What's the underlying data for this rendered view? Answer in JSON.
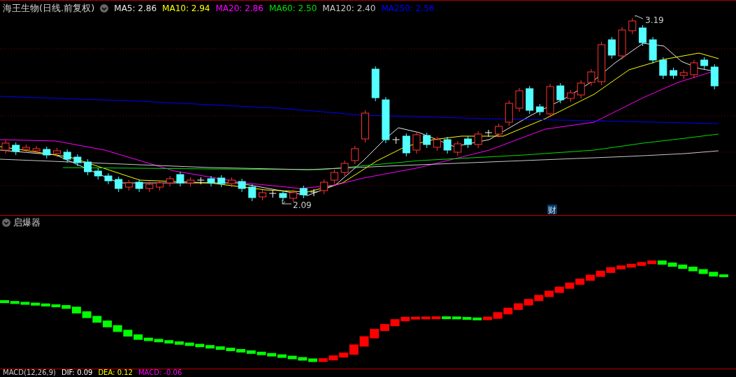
{
  "header": {
    "title": "海王生物(日线.前复权)",
    "indicators": [
      {
        "label": "MA5: 2.86",
        "color": "#e8e8e8"
      },
      {
        "label": "MA10: 2.94",
        "color": "#ffff00"
      },
      {
        "label": "MA20: 2.86",
        "color": "#ff00ff"
      },
      {
        "label": "MA60: 2.50",
        "color": "#00e000"
      },
      {
        "label": "MA120: 2.40",
        "color": "#c8c8c8"
      },
      {
        "label": "MA250: 2.56",
        "color": "#0000ff"
      }
    ]
  },
  "price_chart": {
    "high_label": "3.19",
    "low_label": "2.09",
    "badge": "财"
  },
  "sub_panel": {
    "title": "启爆器"
  },
  "macd_legend": {
    "title": "MACD(12,26,9)",
    "items": [
      {
        "label": "DIF: 0.09",
        "color": "#ffffff"
      },
      {
        "label": "DEA: 0.12",
        "color": "#ffff00"
      },
      {
        "label": "MACD: -0.06",
        "color": "#ff00ff"
      }
    ]
  }
}
